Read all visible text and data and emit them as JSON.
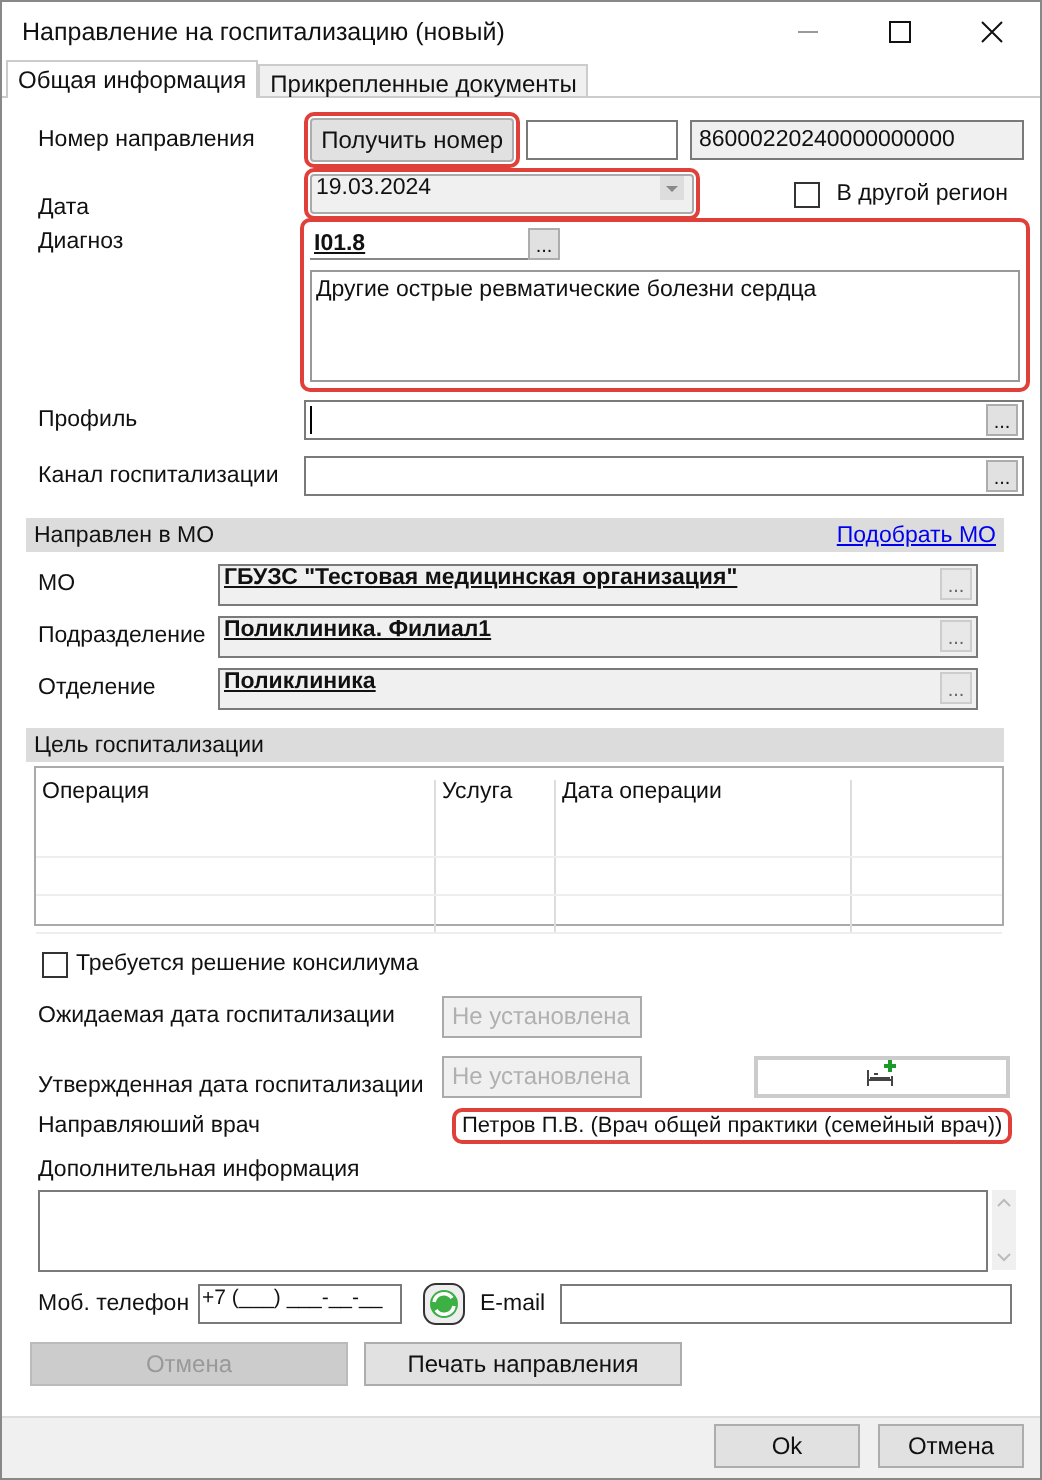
{
  "window": {
    "title": "Направление на госпитализацию (новый)"
  },
  "tabs": [
    {
      "label": "Общая информация",
      "selected": true
    },
    {
      "label": "Прикрепленные документы",
      "selected": false
    }
  ],
  "number": {
    "label": "Номер направления",
    "button": "Получить номер",
    "button_highlighted": true,
    "value": "86000220240000000000"
  },
  "date": {
    "label": "Дата",
    "value": "19.03.2024",
    "highlighted": true
  },
  "other_region": {
    "label": "В другой регион",
    "checked": false
  },
  "diagnosis": {
    "label": "Диагноз",
    "code": "I01.8",
    "browse": "...",
    "text": "Другие острые ревматические болезни сердца",
    "highlighted": true
  },
  "profile": {
    "label": "Профиль",
    "browse": "..."
  },
  "channel": {
    "label": "Канал госпитализации",
    "browse": "..."
  },
  "mo_section": {
    "title": "Направлен в МО",
    "link": "Подобрать МО",
    "fields": [
      {
        "label": "МО",
        "value": "ГБУЗС \"Тестовая медицинская организация\"",
        "browse": "..."
      },
      {
        "label": "Подразделение",
        "value": "Поликлиника. Филиал1",
        "browse": "..."
      },
      {
        "label": "Отделение",
        "value": "Поликлиника",
        "browse": "..."
      }
    ]
  },
  "goal_section": {
    "title": "Цель госпитализации",
    "columns": [
      "Операция",
      "Услуга",
      "Дата операции"
    ]
  },
  "council": {
    "label": "Требуется решение консилиума",
    "checked": false
  },
  "expected_date": {
    "label": "Ожидаемая дата госпитализации",
    "value": "Не установлена"
  },
  "approved_date": {
    "label": "Утвержденная дата госпитализации",
    "value": "Не установлена"
  },
  "doctor": {
    "label": "Направляюший врач",
    "value": "Петров П.В. (Врач общей практики (семейный врач))",
    "highlighted": true
  },
  "additional": {
    "label": "Дополнительная информация"
  },
  "phone": {
    "label": "Моб. телефон",
    "value": "+7 (___) ___-__-__"
  },
  "email": {
    "label": "E-mail"
  },
  "actions": [
    {
      "label": "Отмена",
      "disabled": true
    },
    {
      "label": "Печать направления",
      "disabled": false
    }
  ],
  "footer_buttons": [
    "Ok",
    "Отмена"
  ]
}
